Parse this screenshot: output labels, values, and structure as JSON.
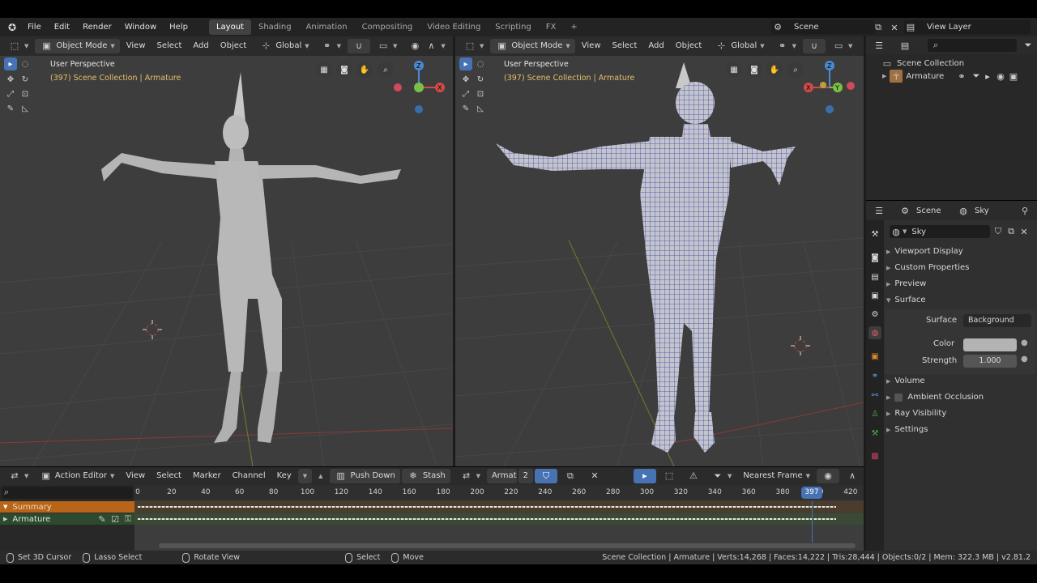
{
  "menu": {
    "items": [
      "File",
      "Edit",
      "Render",
      "Window",
      "Help"
    ]
  },
  "workspaces": [
    "Layout",
    "Shading",
    "Animation",
    "Compositing",
    "Video Editing",
    "Scripting",
    "FX"
  ],
  "active_workspace": "Layout",
  "add_tab": "+",
  "scene": {
    "label": "Scene",
    "view_layer": "View Layer"
  },
  "viewport_left": {
    "mode": "Object Mode",
    "menus": [
      "View",
      "Select",
      "Add",
      "Object"
    ],
    "transform": "Global",
    "title": "User Perspective",
    "subtitle": "(397) Scene Collection | Armature"
  },
  "viewport_right": {
    "mode": "Object Mode",
    "menus": [
      "View",
      "Select",
      "Add",
      "Object"
    ],
    "transform": "Global",
    "title": "User Perspective",
    "subtitle": "(397) Scene Collection | Armature"
  },
  "outliner": {
    "root": "Scene Collection",
    "child": "Armature"
  },
  "properties": {
    "context_scene": "Scene",
    "context_world": "Sky",
    "world_name": "Sky",
    "sections": [
      "Viewport Display",
      "Custom Properties",
      "Preview",
      "Surface"
    ],
    "surface_label": "Surface",
    "surface_value": "Background",
    "color_label": "Color",
    "strength_label": "Strength",
    "strength_value": "1.000",
    "sections2": [
      "Volume",
      "Ambient Occlusion",
      "Ray Visibility",
      "Settings"
    ]
  },
  "colors": {
    "accent": "#4772b3",
    "frame": "#4772b3",
    "summary": "#c5761b",
    "armature_row": "#2e4a2e",
    "selected_text": "#e3c06a"
  },
  "timeline": {
    "editor": "Action Editor",
    "menus": [
      "View",
      "Select",
      "Marker",
      "Channel",
      "Key"
    ],
    "push_down": "Push Down",
    "stash": "Stash",
    "action_name": "Armature|mixamo...",
    "users": "2",
    "snap": "Nearest Frame",
    "ticks": [
      "0",
      "20",
      "40",
      "60",
      "80",
      "100",
      "120",
      "140",
      "160",
      "180",
      "200",
      "220",
      "240",
      "260",
      "280",
      "300",
      "320",
      "340",
      "360",
      "380",
      "400",
      "420"
    ],
    "current_frame": "397",
    "channels": [
      "Summary",
      "Armature"
    ]
  },
  "status": {
    "items": [
      "Set 3D Cursor",
      "Lasso Select",
      "Rotate View",
      "Select",
      "Move"
    ],
    "info": "Scene Collection | Armature | Verts:14,268 | Faces:14,222 | Tris:28,444 | Objects:0/2 | Mem: 322.3 MB | v2.81.2"
  }
}
